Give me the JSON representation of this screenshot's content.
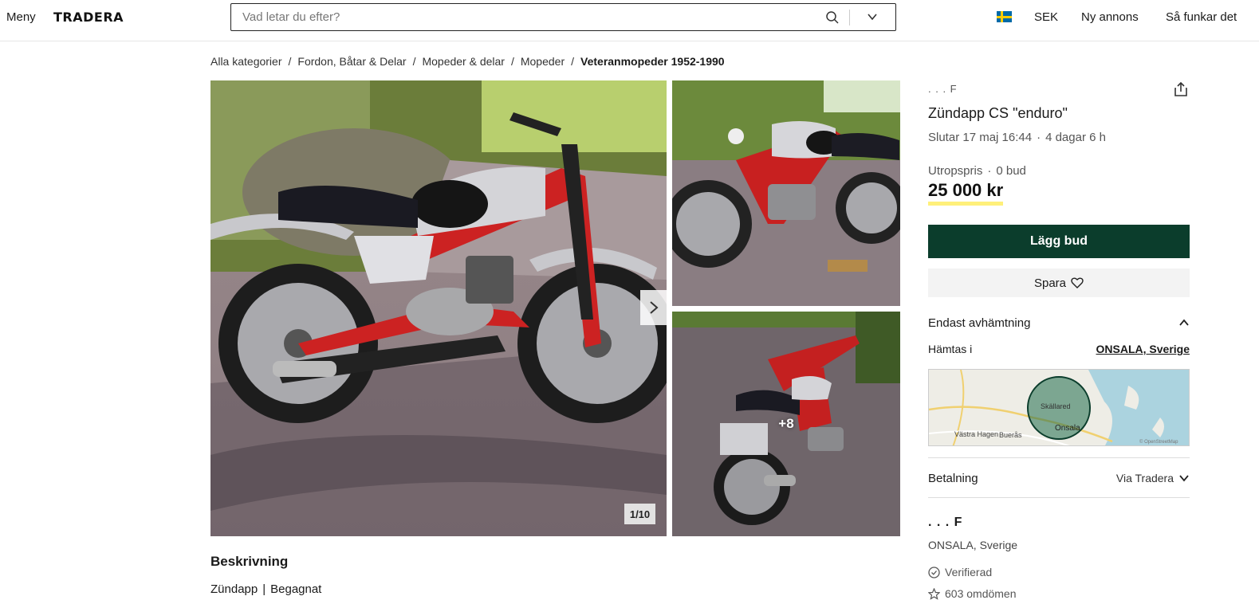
{
  "header": {
    "menu_label": "Meny",
    "logo_text": "TRADERA",
    "search_placeholder": "Vad letar du efter?",
    "currency": "SEK",
    "new_listing": "Ny annons",
    "how_it_works": "Så funkar det"
  },
  "breadcrumb": [
    "Alla kategorier",
    "Fordon, Båtar & Delar",
    "Mopeder & delar",
    "Mopeder",
    "Veteranmopeder 1952-1990"
  ],
  "gallery": {
    "counter": "1/10",
    "more_label": "+8"
  },
  "description": {
    "heading": "Beskrivning",
    "brand": "Zündapp",
    "condition": "Begagnat"
  },
  "listing": {
    "seller_short": ". . . F",
    "title": "Zündapp CS \"enduro\"",
    "ends_label": "Slutar 17 maj 16:44",
    "time_left": "4 dagar 6 h",
    "price_label": "Utropspris",
    "bids": "0 bud",
    "price": "25 000 kr",
    "bid_button": "Lägg bud",
    "save_button": "Spara"
  },
  "shipping": {
    "label": "Endast avhämtning",
    "fetch_label": "Hämtas i",
    "fetch_location": "ONSALA, Sverige",
    "map_labels": [
      "Skällared",
      "Onsala",
      "Västra Hagen",
      "Buerås",
      "© OpenStreetMap"
    ]
  },
  "payment": {
    "label": "Betalning",
    "value": "Via Tradera"
  },
  "seller": {
    "name": ". . . F",
    "location": "ONSALA, Sverige",
    "verified": "Verifierad",
    "reviews": "603 omdömen"
  },
  "colors": {
    "accent": "#0b3d2c",
    "price_underline": "#fff07a"
  }
}
